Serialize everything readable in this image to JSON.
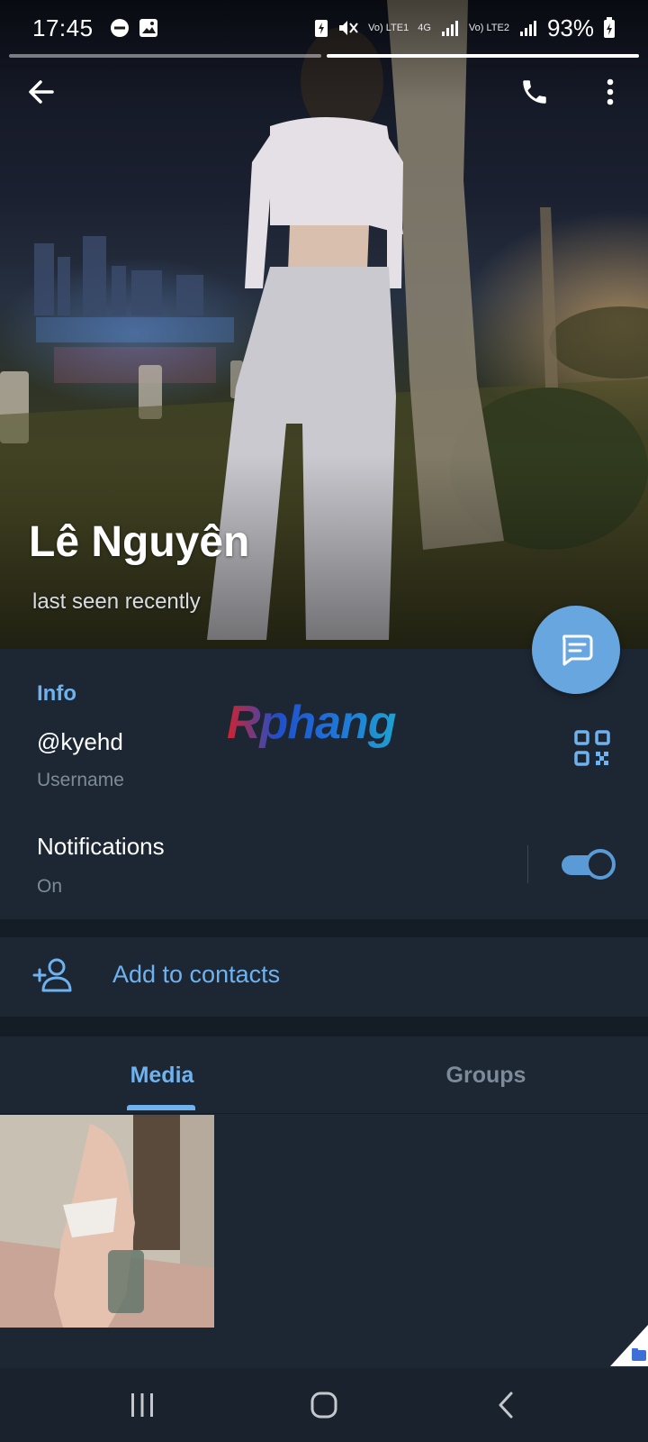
{
  "status_bar": {
    "time": "17:45",
    "net_sim1": "Vo) LTE1",
    "net_type": "4G",
    "net_sim2": "Vo) LTE2",
    "battery": "93%"
  },
  "profile": {
    "name": "Lê Nguyên",
    "status": "last seen recently"
  },
  "info": {
    "section_title": "Info",
    "watermark": "Rphang",
    "username_value": "@kyehd",
    "username_label": "Username",
    "notifications_title": "Notifications",
    "notifications_value": "On",
    "notifications_enabled": true
  },
  "actions": {
    "add_contact_label": "Add to contacts"
  },
  "tabs": [
    {
      "label": "Media",
      "active": true
    },
    {
      "label": "Groups",
      "active": false
    }
  ],
  "colors": {
    "accent": "#6eb2f0",
    "fab": "#68a6e0",
    "background": "#1d2733",
    "secondary_text": "#7d8b99"
  },
  "icons": {
    "back": "arrow-left-icon",
    "call": "phone-icon",
    "menu": "more-vertical-icon",
    "message": "chat-bubble-icon",
    "qr": "qr-code-icon",
    "add_contact": "add-person-icon"
  }
}
